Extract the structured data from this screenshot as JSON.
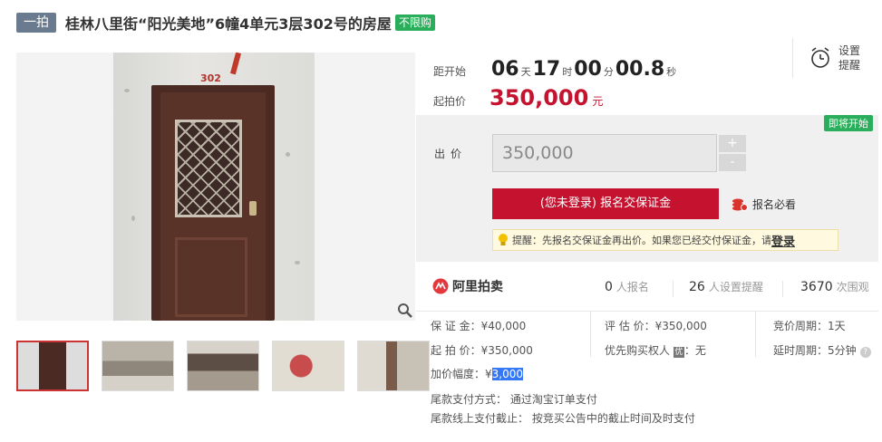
{
  "header": {
    "auction_badge": "一拍",
    "title": "桂林八里街“阳光美地”6幢4单元3层302号的房屋",
    "unlimited_badge": "不限购"
  },
  "gallery": {
    "door_number": "302",
    "thumbnail_count": 5
  },
  "countdown": {
    "label": "距开始",
    "days": "06",
    "days_unit": "天",
    "hours": "17",
    "hours_unit": "时",
    "minutes": "00",
    "minutes_unit": "分",
    "seconds": "00.8",
    "seconds_unit": "秒"
  },
  "start_price": {
    "label": "起拍价",
    "value": "350,000",
    "unit": "元"
  },
  "reminder": {
    "label": "设置提醒"
  },
  "bid": {
    "status_badge": "即将开始",
    "label": "出价",
    "input_value": "350,000",
    "plus": "+",
    "minus": "-",
    "signup_button": "(您未登录) 报名交保证金",
    "must_see": "报名必看",
    "tip_text": "提醒：先报名交保证金再出价。如果您已经交付保证金，请",
    "tip_login": "登录"
  },
  "stats": {
    "brand": "阿里拍卖",
    "signups": "0",
    "signups_unit": "人报名",
    "reminders": "26",
    "reminders_unit": "人设置提醒",
    "views": "3670",
    "views_unit": "次围观"
  },
  "details": {
    "deposit_label": "保 证 金：",
    "deposit_value": "¥40,000",
    "start_label": "起 拍 价：",
    "start_value": "¥350,000",
    "increment_label": "加价幅度：",
    "increment_prefix": "¥",
    "increment_value": "3,000",
    "appraisal_label": "评 估 价：",
    "appraisal_value": "¥350,000",
    "priority_label": "优先购买权人",
    "priority_icon": "优",
    "priority_value": "：无",
    "cycle_label": "竞价周期：",
    "cycle_value": "1天",
    "delay_label": "延时周期：",
    "delay_value": "5分钟",
    "payment_method_label": "尾款支付方式：",
    "payment_method_value": "通过淘宝订单支付",
    "payment_deadline_label": "尾款线上支付截止：",
    "payment_deadline_value": "按竞买公告中的截止时间及时支付"
  },
  "colors": {
    "accent_red": "#c4122f",
    "green_badge": "#2bae5b",
    "gray_badge": "#6a7a8f"
  }
}
